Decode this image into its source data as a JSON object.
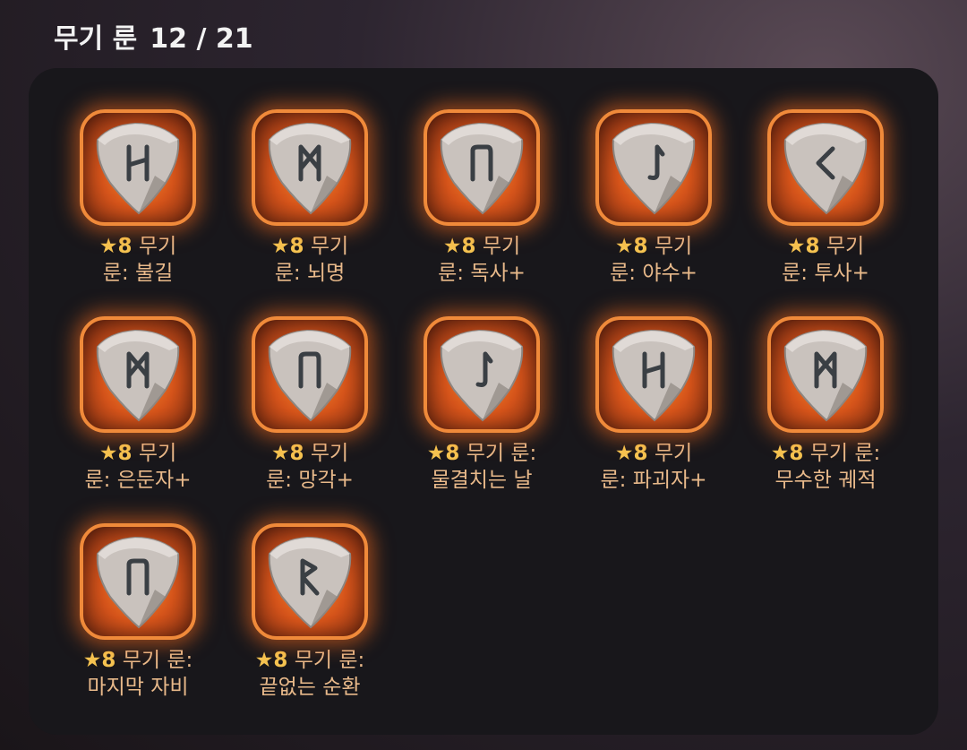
{
  "header": {
    "title": "무기 룬",
    "count": "12 / 21"
  },
  "runes": [
    {
      "star": "★",
      "level": "8",
      "line1": "무기",
      "line2": "룬: 불길",
      "glyph": "H"
    },
    {
      "star": "★",
      "level": "8",
      "line1": "무기",
      "line2": "룬: 뇌명",
      "glyph": "M"
    },
    {
      "star": "★",
      "level": "8",
      "line1": "무기",
      "line2": "룬: 독사+",
      "glyph": "U"
    },
    {
      "star": "★",
      "level": "8",
      "line1": "무기",
      "line2": "룬: 야수+",
      "glyph": "J"
    },
    {
      "star": "★",
      "level": "8",
      "line1": "무기",
      "line2": "룬: 투사+",
      "glyph": "K"
    },
    {
      "star": "★",
      "level": "8",
      "line1": "무기",
      "line2": "룬: 은둔자+",
      "glyph": "M"
    },
    {
      "star": "★",
      "level": "8",
      "line1": "무기",
      "line2": "룬: 망각+",
      "glyph": "U"
    },
    {
      "star": "★",
      "level": "8",
      "line1": "무기 룬:",
      "line2": "물결치는 날",
      "glyph": "J"
    },
    {
      "star": "★",
      "level": "8",
      "line1": "무기",
      "line2": "룬: 파괴자+",
      "glyph": "H"
    },
    {
      "star": "★",
      "level": "8",
      "line1": "무기 룬:",
      "line2": "무수한 궤적",
      "glyph": "M"
    },
    {
      "star": "★",
      "level": "8",
      "line1": "무기 룬:",
      "line2": "마지막 자비",
      "glyph": "U"
    },
    {
      "star": "★",
      "level": "8",
      "line1": "무기 룬:",
      "line2": "끝없는 순환",
      "glyph": "R"
    }
  ],
  "colors": {
    "frame": "#f08a3a",
    "glow": "#ff6e1e",
    "label": "#e8b98a",
    "star": "#f5c451",
    "panel": "#18171b"
  }
}
